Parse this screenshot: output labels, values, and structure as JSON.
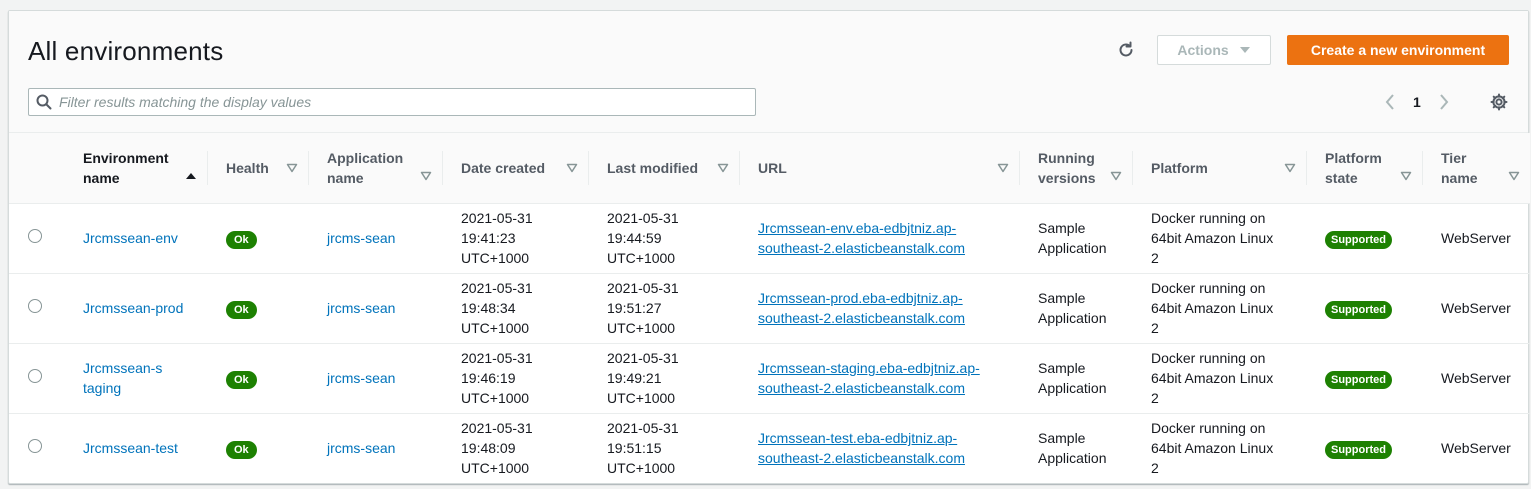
{
  "page": {
    "title": "All environments",
    "refresh_icon": "refresh-icon",
    "actions_label": "Actions",
    "create_label": "Create a new environment",
    "search_placeholder": "Filter results matching the display values",
    "current_page": "1",
    "accent_color": "#ec7211",
    "link_color": "#0073bb",
    "status_color": "#1d8102"
  },
  "columns": [
    {
      "label": "Environment name",
      "sorted": "ascending"
    },
    {
      "label": "Health"
    },
    {
      "label": "Application name"
    },
    {
      "label": "Date created"
    },
    {
      "label": "Last modified"
    },
    {
      "label": "URL"
    },
    {
      "label": "Running versions"
    },
    {
      "label": "Platform"
    },
    {
      "label": "Platform state"
    },
    {
      "label": "Tier name"
    }
  ],
  "rows": [
    {
      "env": "Jrcmssean-env",
      "health": "Ok",
      "app": "jrcms-sean",
      "created": [
        "2021-05-31",
        "19:41:23",
        "UTC+1000"
      ],
      "modified": [
        "2021-05-31",
        "19:44:59",
        "UTC+1000"
      ],
      "url": [
        "Jrcmssean-env.eba-edbjtniz.ap-",
        "southeast-2.elasticbeanstalk.com"
      ],
      "versions": [
        "Sample",
        "Application"
      ],
      "platform": [
        "Docker running on",
        "64bit Amazon Linux",
        "2"
      ],
      "state": "Supported",
      "tier": "WebServer"
    },
    {
      "env": "Jrcmssean-prod",
      "health": "Ok",
      "app": "jrcms-sean",
      "created": [
        "2021-05-31",
        "19:48:34",
        "UTC+1000"
      ],
      "modified": [
        "2021-05-31",
        "19:51:27",
        "UTC+1000"
      ],
      "url": [
        "Jrcmssean-prod.eba-edbjtniz.ap-",
        "southeast-2.elasticbeanstalk.com"
      ],
      "versions": [
        "Sample",
        "Application"
      ],
      "platform": [
        "Docker running on",
        "64bit Amazon Linux",
        "2"
      ],
      "state": "Supported",
      "tier": "WebServer"
    },
    {
      "env": "Jrcmssean-staging",
      "health": "Ok",
      "app": "jrcms-sean",
      "created": [
        "2021-05-31",
        "19:46:19",
        "UTC+1000"
      ],
      "modified": [
        "2021-05-31",
        "19:49:21",
        "UTC+1000"
      ],
      "url": [
        "Jrcmssean-staging.eba-edbjtniz.ap-",
        "southeast-2.elasticbeanstalk.com"
      ],
      "versions": [
        "Sample",
        "Application"
      ],
      "platform": [
        "Docker running on",
        "64bit Amazon Linux",
        "2"
      ],
      "state": "Supported",
      "tier": "WebServer"
    },
    {
      "env": "Jrcmssean-test",
      "health": "Ok",
      "app": "jrcms-sean",
      "created": [
        "2021-05-31",
        "19:48:09",
        "UTC+1000"
      ],
      "modified": [
        "2021-05-31",
        "19:51:15",
        "UTC+1000"
      ],
      "url": [
        "Jrcmssean-test.eba-edbjtniz.ap-",
        "southeast-2.elasticbeanstalk.com"
      ],
      "versions": [
        "Sample",
        "Application"
      ],
      "platform": [
        "Docker running on",
        "64bit Amazon Linux",
        "2"
      ],
      "state": "Supported",
      "tier": "WebServer"
    }
  ]
}
